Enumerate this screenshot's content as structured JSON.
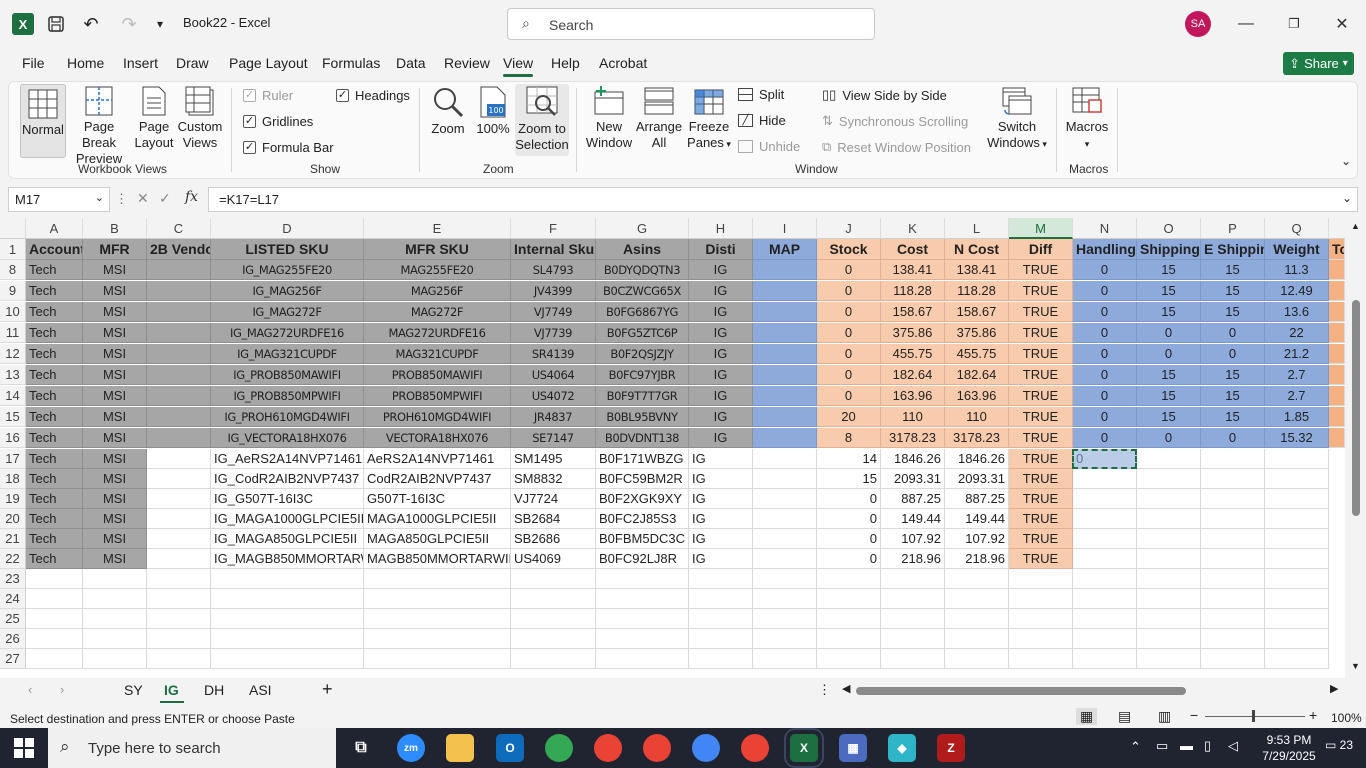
{
  "titlebar": {
    "app_icon": "X",
    "book_title": "Book22 - Excel",
    "search_placeholder": "Search",
    "avatar_initials": "SA"
  },
  "menu": [
    "File",
    "Home",
    "Insert",
    "Draw",
    "Page Layout",
    "Formulas",
    "Data",
    "Review",
    "View",
    "Help",
    "Acrobat"
  ],
  "active_menu": "View",
  "share_label": "Share",
  "ribbon": {
    "workbook_views": {
      "label": "Workbook Views",
      "normal": "Normal",
      "page_break_1": "Page Break",
      "page_break_2": "Preview",
      "page_layout_1": "Page",
      "page_layout_2": "Layout",
      "custom_1": "Custom",
      "custom_2": "Views"
    },
    "show": {
      "label": "Show",
      "ruler": "Ruler",
      "gridlines": "Gridlines",
      "formula_bar": "Formula Bar",
      "headings": "Headings"
    },
    "zoom": {
      "label": "Zoom",
      "zoom": "Zoom",
      "hundred": "100%",
      "zts_1": "Zoom to",
      "zts_2": "Selection"
    },
    "window": {
      "label": "Window",
      "new_1": "New",
      "new_2": "Window",
      "arrange_1": "Arrange",
      "arrange_2": "All",
      "freeze_1": "Freeze",
      "freeze_2": "Panes",
      "split": "Split",
      "hide": "Hide",
      "unhide": "Unhide",
      "side_by_side": "View Side by Side",
      "sync_scroll": "Synchronous Scrolling",
      "reset_pos": "Reset Window Position",
      "switch_1": "Switch",
      "switch_2": "Windows"
    },
    "macros": {
      "label": "Macros",
      "macros": "Macros"
    }
  },
  "formula_bar": {
    "name_box": "M17",
    "formula": "=K17=L17"
  },
  "columns": [
    "A",
    "B",
    "C",
    "D",
    "E",
    "F",
    "G",
    "H",
    "I",
    "J",
    "K",
    "L",
    "M",
    "N",
    "O",
    "P",
    "Q"
  ],
  "header_row": {
    "row_num": "1",
    "cells": [
      "Account",
      "MFR",
      "2B Vendor",
      "LISTED SKU",
      "MFR SKU",
      "Internal Sku",
      "Asins",
      "Disti",
      "MAP",
      "Stock",
      "Cost",
      "N Cost",
      "Diff",
      "Handling",
      "Shipping",
      "E Shipping",
      "Weight",
      "To"
    ]
  },
  "rows": [
    {
      "n": "8",
      "v": [
        "Tech",
        "MSI",
        "",
        "IG_MAG255FE20",
        "MAG255FE20",
        "SL4793",
        "B0DYQDQTN3",
        "IG",
        "",
        "0",
        "138.41",
        "138.41",
        "TRUE",
        "0",
        "15",
        "15",
        "11.3"
      ]
    },
    {
      "n": "9",
      "v": [
        "Tech",
        "MSI",
        "",
        "IG_MAG256F",
        "MAG256F",
        "JV4399",
        "B0CZWCG65X",
        "IG",
        "",
        "0",
        "118.28",
        "118.28",
        "TRUE",
        "0",
        "15",
        "15",
        "12.49"
      ]
    },
    {
      "n": "10",
      "v": [
        "Tech",
        "MSI",
        "",
        "IG_MAG272F",
        "MAG272F",
        "VJ7749",
        "B0FG6867YG",
        "IG",
        "",
        "0",
        "158.67",
        "158.67",
        "TRUE",
        "0",
        "15",
        "15",
        "13.6"
      ]
    },
    {
      "n": "11",
      "v": [
        "Tech",
        "MSI",
        "",
        "IG_MAG272URDFE16",
        "MAG272URDFE16",
        "VJ7739",
        "B0FG5ZTC6P",
        "IG",
        "",
        "0",
        "375.86",
        "375.86",
        "TRUE",
        "0",
        "0",
        "0",
        "22"
      ]
    },
    {
      "n": "12",
      "v": [
        "Tech",
        "MSI",
        "",
        "IG_MAG321CUPDF",
        "MAG321CUPDF",
        "SR4139",
        "B0F2QSJZJY",
        "IG",
        "",
        "0",
        "455.75",
        "455.75",
        "TRUE",
        "0",
        "0",
        "0",
        "21.2"
      ]
    },
    {
      "n": "13",
      "v": [
        "Tech",
        "MSI",
        "",
        "IG_PROB850MAWIFI",
        "PROB850MAWIFI",
        "US4064",
        "B0FC97YJBR",
        "IG",
        "",
        "0",
        "182.64",
        "182.64",
        "TRUE",
        "0",
        "15",
        "15",
        "2.7"
      ]
    },
    {
      "n": "14",
      "v": [
        "Tech",
        "MSI",
        "",
        "IG_PROB850MPWIFI",
        "PROB850MPWIFI",
        "US4072",
        "B0F9T7T7GR",
        "IG",
        "",
        "0",
        "163.96",
        "163.96",
        "TRUE",
        "0",
        "15",
        "15",
        "2.7"
      ]
    },
    {
      "n": "15",
      "v": [
        "Tech",
        "MSI",
        "",
        "IG_PROH610MGD4WIFI",
        "PROH610MGD4WIFI",
        "JR4837",
        "B0BL95BVNY",
        "IG",
        "",
        "20",
        "110",
        "110",
        "TRUE",
        "0",
        "15",
        "15",
        "1.85"
      ]
    },
    {
      "n": "16",
      "v": [
        "Tech",
        "MSI",
        "",
        "IG_VECTORA18HX076",
        "VECTORA18HX076",
        "SE7147",
        "B0DVDNT138",
        "IG",
        "",
        "8",
        "3178.23",
        "3178.23",
        "TRUE",
        "0",
        "0",
        "0",
        "15.32"
      ]
    },
    {
      "n": "17",
      "v": [
        "Tech",
        "MSI",
        "",
        "IG_AeRS2A14NVP71461",
        "AeRS2A14NVP71461",
        "SM1495",
        "B0F171WBZG",
        "IG",
        "",
        "14",
        "1846.26",
        "1846.26",
        "TRUE",
        "0",
        "",
        "",
        ""
      ]
    },
    {
      "n": "18",
      "v": [
        "Tech",
        "MSI",
        "",
        "IG_CodR2AIB2NVP7437",
        "CodR2AIB2NVP7437",
        "SM8832",
        "B0FC59BM2R",
        "IG",
        "",
        "15",
        "2093.31",
        "2093.31",
        "TRUE",
        "",
        "",
        "",
        ""
      ]
    },
    {
      "n": "19",
      "v": [
        "Tech",
        "MSI",
        "",
        "IG_G507T-16I3C",
        "G507T-16I3C",
        "VJ7724",
        "B0F2XGK9XY",
        "IG",
        "",
        "0",
        "887.25",
        "887.25",
        "TRUE",
        "",
        "",
        "",
        ""
      ]
    },
    {
      "n": "20",
      "v": [
        "Tech",
        "MSI",
        "",
        "IG_MAGA1000GLPCIE5II",
        "MAGA1000GLPCIE5II",
        "SB2684",
        "B0FC2J85S3",
        "IG",
        "",
        "0",
        "149.44",
        "149.44",
        "TRUE",
        "",
        "",
        "",
        ""
      ]
    },
    {
      "n": "21",
      "v": [
        "Tech",
        "MSI",
        "",
        "IG_MAGA850GLPCIE5II",
        "MAGA850GLPCIE5II",
        "SB2686",
        "B0FBM5DC3C",
        "IG",
        "",
        "0",
        "107.92",
        "107.92",
        "TRUE",
        "",
        "",
        "",
        ""
      ]
    },
    {
      "n": "22",
      "v": [
        "Tech",
        "MSI",
        "",
        "IG_MAGB850MMORTARWIFI",
        "MAGB850MMORTARWIFI",
        "US4069",
        "B0FC92LJ8R",
        "IG",
        "",
        "0",
        "218.96",
        "218.96",
        "TRUE",
        "",
        "",
        "",
        ""
      ]
    },
    {
      "n": "23",
      "v": []
    },
    {
      "n": "24",
      "v": []
    },
    {
      "n": "25",
      "v": []
    },
    {
      "n": "26",
      "v": []
    },
    {
      "n": "27",
      "v": []
    }
  ],
  "sheet_tabs": [
    "SY",
    "IG",
    "DH",
    "ASI"
  ],
  "active_sheet": "IG",
  "status": {
    "message": "Select destination and press ENTER or choose Paste",
    "zoom": "100%"
  },
  "taskbar": {
    "search_placeholder": "Type here to search",
    "time": "9:53 PM",
    "date": "7/29/2025",
    "notifications": "23"
  },
  "colors": {
    "excel_green": "#1d6f42",
    "gray_fill": "#a6a6a6",
    "blue_fill": "#8eaadb",
    "peach_fill": "#f8cbad",
    "orange_fill": "#f4b183"
  }
}
